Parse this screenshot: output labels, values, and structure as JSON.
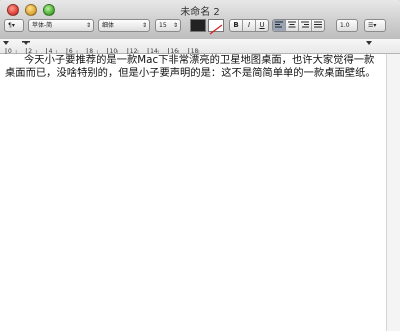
{
  "window": {
    "title": "未命名 2"
  },
  "toolbar": {
    "paragraph_style": "¶▾",
    "font_family": "苹体-简",
    "font_typeface": "细体",
    "font_size": "15",
    "bold": "B",
    "italic": "I",
    "underline": "U",
    "line_spacing": "1.0",
    "list": "☰▾"
  },
  "ruler": {
    "ticks": [
      "0",
      "2",
      "4",
      "6",
      "8",
      "10",
      "12",
      "14",
      "16",
      "18"
    ]
  },
  "document": {
    "text": "今天小子要推荐的是一款Mac下非常漂亮的卫星地图桌面，也许大家觉得一款桌面而已，没啥特别的，但是小子要声明的是：这不是简简单单的一款桌面壁纸。"
  }
}
